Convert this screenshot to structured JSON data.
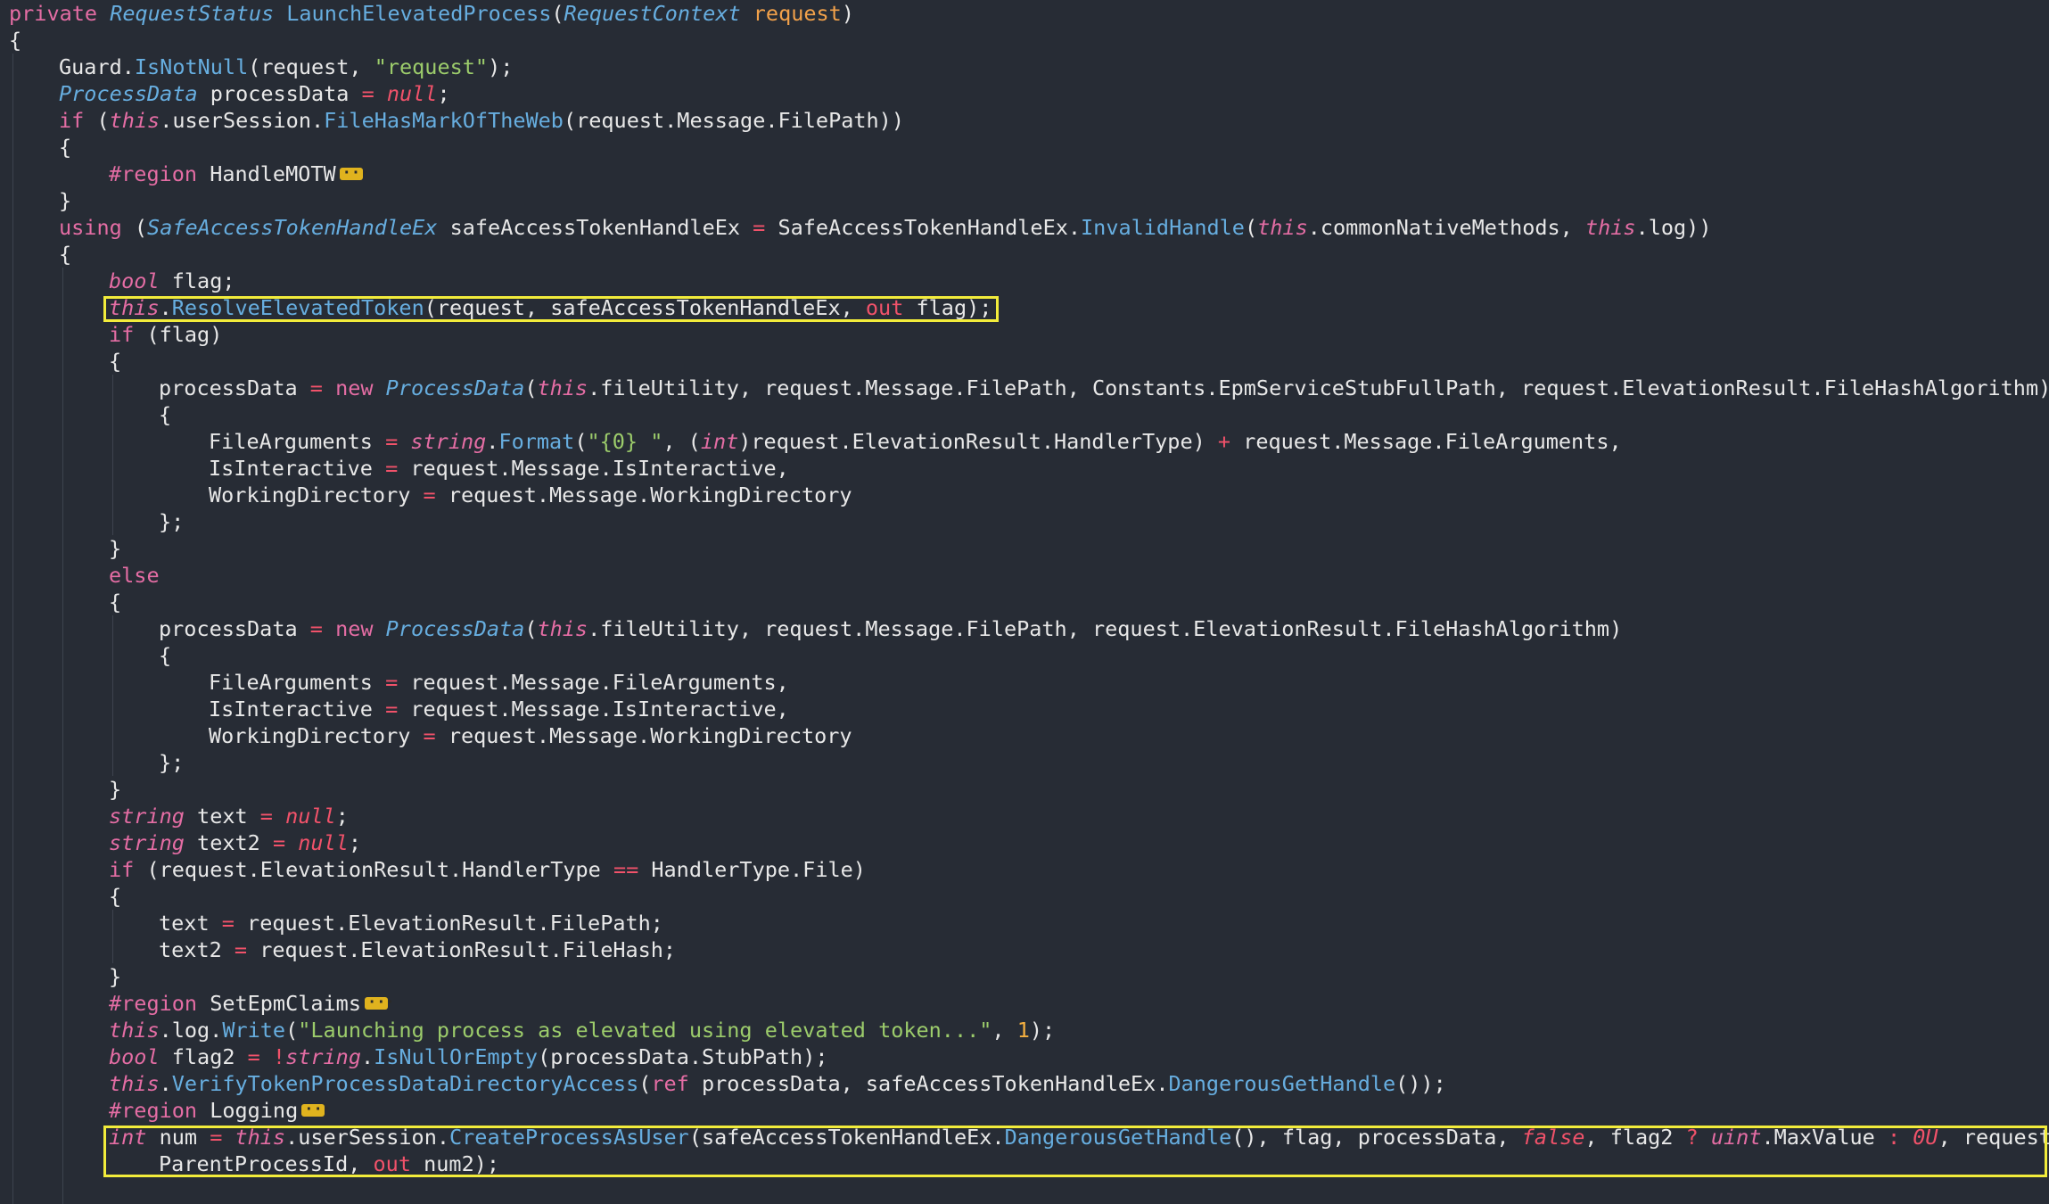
{
  "editor": {
    "language": "C#",
    "highlight_color": "#f2ec3b",
    "folded_regions": [
      "HandleMOTW",
      "SetEpmClaims",
      "Logging"
    ],
    "lines": [
      {
        "indent": 0,
        "tokens": [
          [
            "kw",
            "private "
          ],
          [
            "type",
            "RequestStatus "
          ],
          [
            "meth",
            "LaunchElevatedProcess"
          ],
          [
            "",
            "("
          ],
          [
            "type",
            "RequestContext "
          ],
          [
            "param",
            "request"
          ],
          [
            "",
            ")"
          ]
        ]
      },
      {
        "indent": 0,
        "tokens": [
          [
            "",
            "{"
          ]
        ]
      },
      {
        "indent": 1,
        "tokens": [
          [
            "",
            "Guard."
          ],
          [
            "meth",
            "IsNotNull"
          ],
          [
            "",
            "(request, "
          ],
          [
            "str",
            "\"request\""
          ],
          [
            "",
            ");"
          ]
        ]
      },
      {
        "indent": 1,
        "tokens": [
          [
            "type",
            "ProcessData "
          ],
          [
            "",
            "processData "
          ],
          [
            "op",
            "= "
          ],
          [
            "lit",
            "null"
          ],
          [
            "",
            ";"
          ]
        ]
      },
      {
        "indent": 1,
        "tokens": [
          [
            "kw",
            "if "
          ],
          [
            "",
            "("
          ],
          [
            "kwi",
            "this"
          ],
          [
            "",
            ".userSession."
          ],
          [
            "meth",
            "FileHasMarkOfTheWeb"
          ],
          [
            "",
            "(request.Message.FilePath))"
          ]
        ]
      },
      {
        "indent": 1,
        "tokens": [
          [
            "",
            "{"
          ]
        ]
      },
      {
        "indent": 2,
        "tokens": [
          [
            "kw",
            "#region "
          ],
          [
            "",
            "HandleMOTW"
          ],
          [
            "fold",
            ""
          ]
        ]
      },
      {
        "indent": 1,
        "tokens": [
          [
            "",
            "}"
          ]
        ]
      },
      {
        "indent": 1,
        "tokens": [
          [
            "kw",
            "using "
          ],
          [
            "",
            "("
          ],
          [
            "type",
            "SafeAccessTokenHandleEx "
          ],
          [
            "",
            "safeAccessTokenHandleEx "
          ],
          [
            "op",
            "= "
          ],
          [
            "",
            "SafeAccessTokenHandleEx."
          ],
          [
            "meth",
            "InvalidHandle"
          ],
          [
            "",
            "("
          ],
          [
            "kwi",
            "this"
          ],
          [
            "",
            ".commonNativeMethods, "
          ],
          [
            "kwi",
            "this"
          ],
          [
            "",
            ".log))"
          ]
        ]
      },
      {
        "indent": 1,
        "tokens": [
          [
            "",
            "{"
          ]
        ]
      },
      {
        "indent": 2,
        "tokens": [
          [
            "kwi",
            "bool "
          ],
          [
            "",
            "flag;"
          ]
        ]
      },
      {
        "indent": 2,
        "tokens": [
          [
            "kwi",
            "this"
          ],
          [
            "",
            "."
          ],
          [
            "meth",
            "ResolveElevatedToken"
          ],
          [
            "",
            "(request, safeAccessTokenHandleEx, "
          ],
          [
            "op",
            "out "
          ],
          [
            "",
            "flag);"
          ]
        ]
      },
      {
        "indent": 2,
        "tokens": [
          [
            "kw",
            "if "
          ],
          [
            "",
            "(flag)"
          ]
        ]
      },
      {
        "indent": 2,
        "tokens": [
          [
            "",
            "{"
          ]
        ]
      },
      {
        "indent": 3,
        "tokens": [
          [
            "",
            "processData "
          ],
          [
            "op",
            "= "
          ],
          [
            "kw",
            "new "
          ],
          [
            "type",
            "ProcessData"
          ],
          [
            "",
            "("
          ],
          [
            "kwi",
            "this"
          ],
          [
            "",
            ".fileUtility, request.Message.FilePath, Constants.EpmServiceStubFullPath, request.ElevationResult.FileHashAlgorithm)"
          ]
        ]
      },
      {
        "indent": 3,
        "tokens": [
          [
            "",
            "{"
          ]
        ]
      },
      {
        "indent": 4,
        "tokens": [
          [
            "",
            "FileArguments "
          ],
          [
            "op",
            "= "
          ],
          [
            "kwi",
            "string"
          ],
          [
            "",
            "."
          ],
          [
            "meth",
            "Format"
          ],
          [
            "",
            "("
          ],
          [
            "str",
            "\"{0} \""
          ],
          [
            "",
            ", ("
          ],
          [
            "kwi",
            "int"
          ],
          [
            "",
            ")request.ElevationResult.HandlerType) "
          ],
          [
            "op",
            "+ "
          ],
          [
            "",
            "request.Message.FileArguments,"
          ]
        ]
      },
      {
        "indent": 4,
        "tokens": [
          [
            "",
            "IsInteractive "
          ],
          [
            "op",
            "= "
          ],
          [
            "",
            "request.Message.IsInteractive,"
          ]
        ]
      },
      {
        "indent": 4,
        "tokens": [
          [
            "",
            "WorkingDirectory "
          ],
          [
            "op",
            "= "
          ],
          [
            "",
            "request.Message.WorkingDirectory"
          ]
        ]
      },
      {
        "indent": 3,
        "tokens": [
          [
            "",
            "};"
          ]
        ]
      },
      {
        "indent": 2,
        "tokens": [
          [
            "",
            "}"
          ]
        ]
      },
      {
        "indent": 2,
        "tokens": [
          [
            "kw",
            "else"
          ]
        ]
      },
      {
        "indent": 2,
        "tokens": [
          [
            "",
            "{"
          ]
        ]
      },
      {
        "indent": 3,
        "tokens": [
          [
            "",
            "processData "
          ],
          [
            "op",
            "= "
          ],
          [
            "kw",
            "new "
          ],
          [
            "type",
            "ProcessData"
          ],
          [
            "",
            "("
          ],
          [
            "kwi",
            "this"
          ],
          [
            "",
            ".fileUtility, request.Message.FilePath, request.ElevationResult.FileHashAlgorithm)"
          ]
        ]
      },
      {
        "indent": 3,
        "tokens": [
          [
            "",
            "{"
          ]
        ]
      },
      {
        "indent": 4,
        "tokens": [
          [
            "",
            "FileArguments "
          ],
          [
            "op",
            "= "
          ],
          [
            "",
            "request.Message.FileArguments,"
          ]
        ]
      },
      {
        "indent": 4,
        "tokens": [
          [
            "",
            "IsInteractive "
          ],
          [
            "op",
            "= "
          ],
          [
            "",
            "request.Message.IsInteractive,"
          ]
        ]
      },
      {
        "indent": 4,
        "tokens": [
          [
            "",
            "WorkingDirectory "
          ],
          [
            "op",
            "= "
          ],
          [
            "",
            "request.Message.WorkingDirectory"
          ]
        ]
      },
      {
        "indent": 3,
        "tokens": [
          [
            "",
            "};"
          ]
        ]
      },
      {
        "indent": 2,
        "tokens": [
          [
            "",
            "}"
          ]
        ]
      },
      {
        "indent": 2,
        "tokens": [
          [
            "kwi",
            "string "
          ],
          [
            "",
            "text "
          ],
          [
            "op",
            "= "
          ],
          [
            "lit",
            "null"
          ],
          [
            "",
            ";"
          ]
        ]
      },
      {
        "indent": 2,
        "tokens": [
          [
            "kwi",
            "string "
          ],
          [
            "",
            "text2 "
          ],
          [
            "op",
            "= "
          ],
          [
            "lit",
            "null"
          ],
          [
            "",
            ";"
          ]
        ]
      },
      {
        "indent": 2,
        "tokens": [
          [
            "kw",
            "if "
          ],
          [
            "",
            "(request.ElevationResult.HandlerType "
          ],
          [
            "op",
            "== "
          ],
          [
            "",
            "HandlerType.File)"
          ]
        ]
      },
      {
        "indent": 2,
        "tokens": [
          [
            "",
            "{"
          ]
        ]
      },
      {
        "indent": 3,
        "tokens": [
          [
            "",
            "text "
          ],
          [
            "op",
            "= "
          ],
          [
            "",
            "request.ElevationResult.FilePath;"
          ]
        ]
      },
      {
        "indent": 3,
        "tokens": [
          [
            "",
            "text2 "
          ],
          [
            "op",
            "= "
          ],
          [
            "",
            "request.ElevationResult.FileHash;"
          ]
        ]
      },
      {
        "indent": 2,
        "tokens": [
          [
            "",
            "}"
          ]
        ]
      },
      {
        "indent": 2,
        "tokens": [
          [
            "kw",
            "#region "
          ],
          [
            "",
            "SetEpmClaims"
          ],
          [
            "fold",
            ""
          ]
        ]
      },
      {
        "indent": 2,
        "tokens": [
          [
            "kwi",
            "this"
          ],
          [
            "",
            ".log."
          ],
          [
            "meth",
            "Write"
          ],
          [
            "",
            "("
          ],
          [
            "str",
            "\"Launching process as elevated using elevated token...\""
          ],
          [
            "",
            ", "
          ],
          [
            "num",
            "1"
          ],
          [
            "",
            ");"
          ]
        ]
      },
      {
        "indent": 2,
        "tokens": [
          [
            "kwi",
            "bool "
          ],
          [
            "",
            "flag2 "
          ],
          [
            "op",
            "= !"
          ],
          [
            "kwi",
            "string"
          ],
          [
            "",
            "."
          ],
          [
            "meth",
            "IsNullOrEmpty"
          ],
          [
            "",
            "(processData.StubPath);"
          ]
        ]
      },
      {
        "indent": 2,
        "tokens": [
          [
            "kwi",
            "this"
          ],
          [
            "",
            "."
          ],
          [
            "meth",
            "VerifyTokenProcessDataDirectoryAccess"
          ],
          [
            "",
            "("
          ],
          [
            "kw",
            "ref "
          ],
          [
            "",
            "processData, safeAccessTokenHandleEx."
          ],
          [
            "meth",
            "DangerousGetHandle"
          ],
          [
            "",
            "());"
          ]
        ]
      },
      {
        "indent": 2,
        "tokens": [
          [
            "kw",
            "#region "
          ],
          [
            "",
            "Logging"
          ],
          [
            "fold",
            ""
          ]
        ]
      },
      {
        "indent": 2,
        "tokens": [
          [
            "kwi",
            "int "
          ],
          [
            "",
            "num "
          ],
          [
            "op",
            "= "
          ],
          [
            "kwi",
            "this"
          ],
          [
            "",
            ".userSession."
          ],
          [
            "meth",
            "CreateProcessAsUser"
          ],
          [
            "",
            "(safeAccessTokenHandleEx."
          ],
          [
            "meth",
            "DangerousGetHandle"
          ],
          [
            "",
            "(), flag, processData, "
          ],
          [
            "lit",
            "false"
          ],
          [
            "",
            ", flag2 "
          ],
          [
            "op",
            "? "
          ],
          [
            "kwi",
            "uint"
          ],
          [
            "",
            ".MaxValue "
          ],
          [
            "op",
            ": "
          ],
          [
            "lit",
            "0U"
          ],
          [
            "",
            ", request."
          ]
        ]
      },
      {
        "indent": 3,
        "tokens": [
          [
            "",
            "ParentProcessId, "
          ],
          [
            "op",
            "out "
          ],
          [
            "",
            "num2);"
          ]
        ]
      }
    ]
  }
}
